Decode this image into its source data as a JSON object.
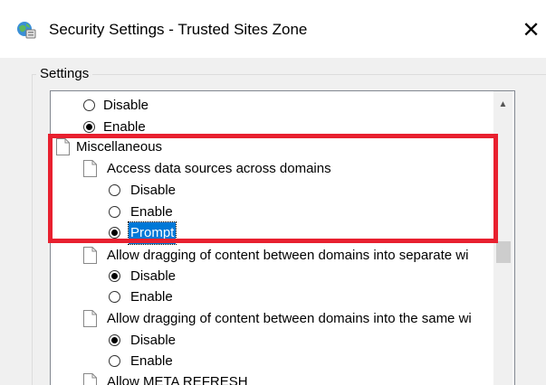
{
  "window": {
    "title": "Security Settings - Trusted Sites Zone",
    "icon": "security-globe-icon",
    "close_glyph": "✕"
  },
  "group": {
    "label": "Settings"
  },
  "settings_list": {
    "items": [
      {
        "type": "option",
        "label": "Disable",
        "checked": false
      },
      {
        "type": "option",
        "label": "Enable",
        "checked": true
      },
      {
        "type": "category",
        "label": "Miscellaneous"
      },
      {
        "type": "setting",
        "label": "Access data sources across domains"
      },
      {
        "type": "option",
        "label": "Disable",
        "checked": false
      },
      {
        "type": "option",
        "label": "Enable",
        "checked": false
      },
      {
        "type": "option",
        "label": "Prompt",
        "checked": true,
        "selected": true
      },
      {
        "type": "setting",
        "label": "Allow dragging of content between domains into separate wi"
      },
      {
        "type": "option",
        "label": "Disable",
        "checked": true
      },
      {
        "type": "option",
        "label": "Enable",
        "checked": false
      },
      {
        "type": "setting",
        "label": "Allow dragging of content between domains into the same wi"
      },
      {
        "type": "option",
        "label": "Disable",
        "checked": true
      },
      {
        "type": "option",
        "label": "Enable",
        "checked": false
      },
      {
        "type": "setting",
        "label": "Allow META REFRESH"
      }
    ]
  },
  "annotation": {
    "color": "#e8202f"
  },
  "colors": {
    "selection": "#0078d7",
    "highlight_border": "#e8202f"
  }
}
